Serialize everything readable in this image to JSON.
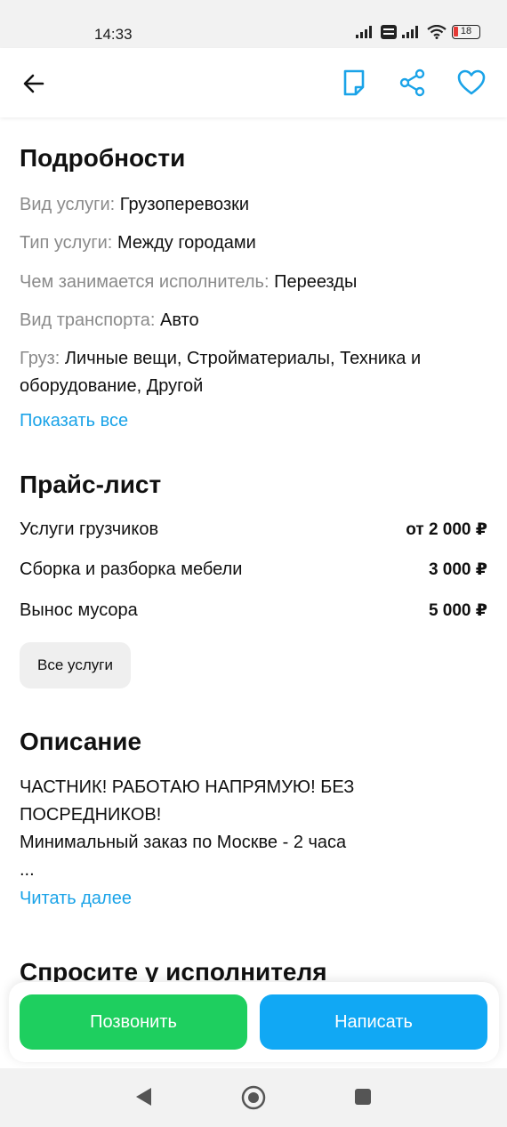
{
  "status_bar": {
    "time": "14:33",
    "battery": "18",
    "icons": [
      "signal-icon",
      "volte-icon",
      "signal-icon",
      "wifi-icon",
      "battery-icon"
    ]
  },
  "header": {
    "icons": [
      "back-arrow-icon",
      "note-icon",
      "share-icon",
      "heart-icon"
    ],
    "accent_color": "#1aa3e8"
  },
  "details": {
    "title": "Подробности",
    "rows": [
      {
        "key": "Вид услуги:",
        "value": "Грузоперевозки"
      },
      {
        "key": "Тип услуги:",
        "value": "Между городами"
      },
      {
        "key": "Чем занимается исполнитель:",
        "value": "Переезды"
      },
      {
        "key": "Вид транспорта:",
        "value": "Авто"
      },
      {
        "key": "Груз:",
        "value": "Личные вещи, Стройматериалы, Техника и оборудование, Другой"
      }
    ],
    "show_all": "Показать все"
  },
  "price_list": {
    "title": "Прайс-лист",
    "items": [
      {
        "name": "Услуги грузчиков",
        "price": "от 2 000 ₽"
      },
      {
        "name": "Сборка и разборка мебели",
        "price": "3 000 ₽"
      },
      {
        "name": "Вынос мусора",
        "price": "5 000 ₽"
      }
    ],
    "all_services": "Все услуги"
  },
  "description": {
    "title": "Описание",
    "line1": "ЧАСТНИК! РАБОТАЮ НАПРЯМУЮ! БЕЗ ПОСРЕДНИКОВ!",
    "line2": "Минимальный заказ по Москве - 2 часа",
    "line3": "...",
    "read_more": "Читать далее"
  },
  "ask": {
    "title": "Спросите у исполнителя"
  },
  "actions": {
    "call": "Позвонить",
    "write": "Написать",
    "call_color": "#1ecf5f",
    "write_color": "#11a8f4"
  },
  "nav_bar": {
    "icons": [
      "back-triangle-icon",
      "home-circle-icon",
      "recents-square-icon"
    ]
  }
}
